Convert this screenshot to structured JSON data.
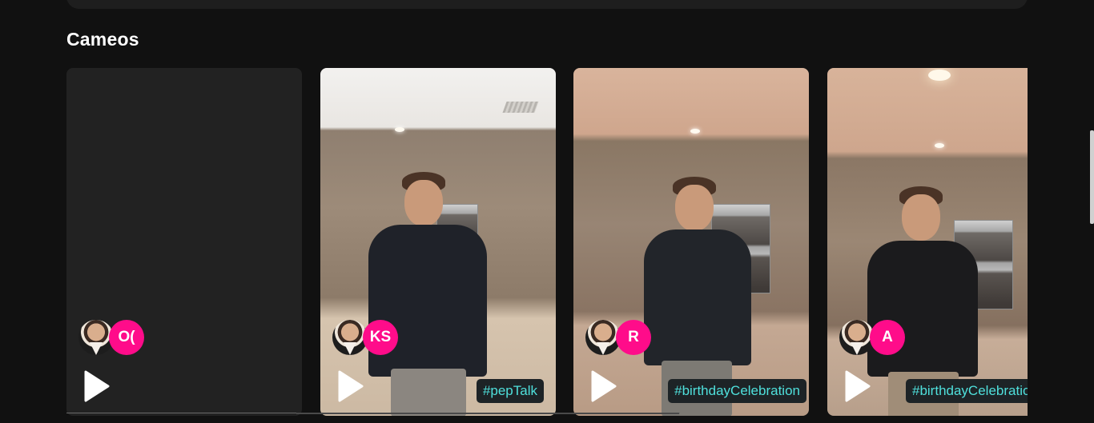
{
  "section": {
    "title": "Cameos"
  },
  "cards": [
    {
      "avatar_initials": "O(",
      "hashtag": ""
    },
    {
      "avatar_initials": "KS",
      "hashtag": "#pepTalk"
    },
    {
      "avatar_initials": "R",
      "hashtag": "#birthdayCelebration"
    },
    {
      "avatar_initials": "A",
      "hashtag": "#birthdayCelebration"
    }
  ],
  "colors": {
    "background": "#111111",
    "card_placeholder": "#222222",
    "avatar_accent": "#ff0c8a",
    "hashtag_text": "#4fe0dc",
    "hashtag_bg": "#1d2326"
  },
  "icons": {
    "play": "play-icon",
    "celebrity_avatar": "celebrity-avatar-photo"
  }
}
